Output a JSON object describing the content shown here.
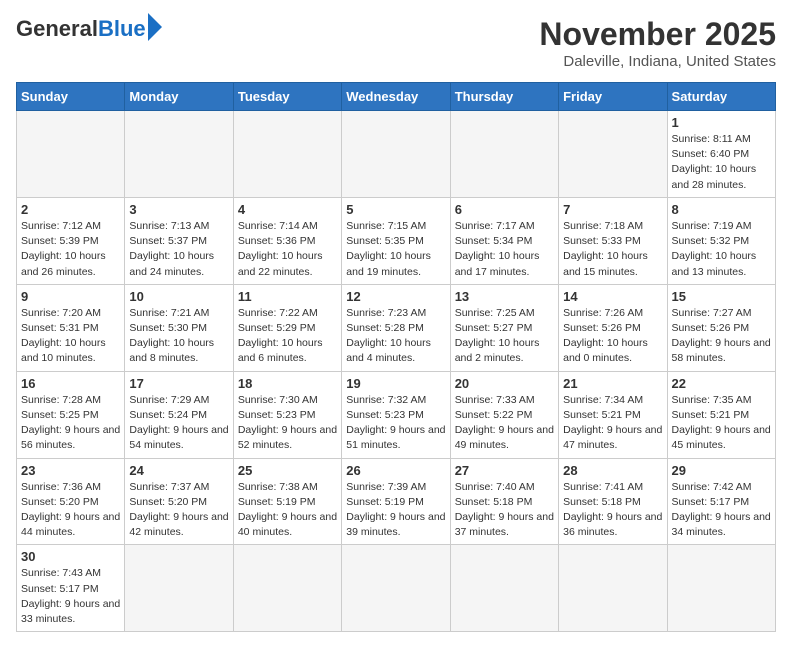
{
  "logo": {
    "general": "General",
    "blue": "Blue"
  },
  "title": "November 2025",
  "location": "Daleville, Indiana, United States",
  "weekdays": [
    "Sunday",
    "Monday",
    "Tuesday",
    "Wednesday",
    "Thursday",
    "Friday",
    "Saturday"
  ],
  "days": [
    {
      "day": "",
      "info": ""
    },
    {
      "day": "",
      "info": ""
    },
    {
      "day": "",
      "info": ""
    },
    {
      "day": "",
      "info": ""
    },
    {
      "day": "",
      "info": ""
    },
    {
      "day": "",
      "info": ""
    },
    {
      "day": "1",
      "info": "Sunrise: 8:11 AM\nSunset: 6:40 PM\nDaylight: 10 hours\nand 28 minutes."
    },
    {
      "day": "2",
      "info": "Sunrise: 7:12 AM\nSunset: 5:39 PM\nDaylight: 10 hours\nand 26 minutes."
    },
    {
      "day": "3",
      "info": "Sunrise: 7:13 AM\nSunset: 5:37 PM\nDaylight: 10 hours\nand 24 minutes."
    },
    {
      "day": "4",
      "info": "Sunrise: 7:14 AM\nSunset: 5:36 PM\nDaylight: 10 hours\nand 22 minutes."
    },
    {
      "day": "5",
      "info": "Sunrise: 7:15 AM\nSunset: 5:35 PM\nDaylight: 10 hours\nand 19 minutes."
    },
    {
      "day": "6",
      "info": "Sunrise: 7:17 AM\nSunset: 5:34 PM\nDaylight: 10 hours\nand 17 minutes."
    },
    {
      "day": "7",
      "info": "Sunrise: 7:18 AM\nSunset: 5:33 PM\nDaylight: 10 hours\nand 15 minutes."
    },
    {
      "day": "8",
      "info": "Sunrise: 7:19 AM\nSunset: 5:32 PM\nDaylight: 10 hours\nand 13 minutes."
    },
    {
      "day": "9",
      "info": "Sunrise: 7:20 AM\nSunset: 5:31 PM\nDaylight: 10 hours\nand 10 minutes."
    },
    {
      "day": "10",
      "info": "Sunrise: 7:21 AM\nSunset: 5:30 PM\nDaylight: 10 hours\nand 8 minutes."
    },
    {
      "day": "11",
      "info": "Sunrise: 7:22 AM\nSunset: 5:29 PM\nDaylight: 10 hours\nand 6 minutes."
    },
    {
      "day": "12",
      "info": "Sunrise: 7:23 AM\nSunset: 5:28 PM\nDaylight: 10 hours\nand 4 minutes."
    },
    {
      "day": "13",
      "info": "Sunrise: 7:25 AM\nSunset: 5:27 PM\nDaylight: 10 hours\nand 2 minutes."
    },
    {
      "day": "14",
      "info": "Sunrise: 7:26 AM\nSunset: 5:26 PM\nDaylight: 10 hours\nand 0 minutes."
    },
    {
      "day": "15",
      "info": "Sunrise: 7:27 AM\nSunset: 5:26 PM\nDaylight: 9 hours\nand 58 minutes."
    },
    {
      "day": "16",
      "info": "Sunrise: 7:28 AM\nSunset: 5:25 PM\nDaylight: 9 hours\nand 56 minutes."
    },
    {
      "day": "17",
      "info": "Sunrise: 7:29 AM\nSunset: 5:24 PM\nDaylight: 9 hours\nand 54 minutes."
    },
    {
      "day": "18",
      "info": "Sunrise: 7:30 AM\nSunset: 5:23 PM\nDaylight: 9 hours\nand 52 minutes."
    },
    {
      "day": "19",
      "info": "Sunrise: 7:32 AM\nSunset: 5:23 PM\nDaylight: 9 hours\nand 51 minutes."
    },
    {
      "day": "20",
      "info": "Sunrise: 7:33 AM\nSunset: 5:22 PM\nDaylight: 9 hours\nand 49 minutes."
    },
    {
      "day": "21",
      "info": "Sunrise: 7:34 AM\nSunset: 5:21 PM\nDaylight: 9 hours\nand 47 minutes."
    },
    {
      "day": "22",
      "info": "Sunrise: 7:35 AM\nSunset: 5:21 PM\nDaylight: 9 hours\nand 45 minutes."
    },
    {
      "day": "23",
      "info": "Sunrise: 7:36 AM\nSunset: 5:20 PM\nDaylight: 9 hours\nand 44 minutes."
    },
    {
      "day": "24",
      "info": "Sunrise: 7:37 AM\nSunset: 5:20 PM\nDaylight: 9 hours\nand 42 minutes."
    },
    {
      "day": "25",
      "info": "Sunrise: 7:38 AM\nSunset: 5:19 PM\nDaylight: 9 hours\nand 40 minutes."
    },
    {
      "day": "26",
      "info": "Sunrise: 7:39 AM\nSunset: 5:19 PM\nDaylight: 9 hours\nand 39 minutes."
    },
    {
      "day": "27",
      "info": "Sunrise: 7:40 AM\nSunset: 5:18 PM\nDaylight: 9 hours\nand 37 minutes."
    },
    {
      "day": "28",
      "info": "Sunrise: 7:41 AM\nSunset: 5:18 PM\nDaylight: 9 hours\nand 36 minutes."
    },
    {
      "day": "29",
      "info": "Sunrise: 7:42 AM\nSunset: 5:17 PM\nDaylight: 9 hours\nand 34 minutes."
    },
    {
      "day": "30",
      "info": "Sunrise: 7:43 AM\nSunset: 5:17 PM\nDaylight: 9 hours\nand 33 minutes."
    },
    {
      "day": "",
      "info": ""
    },
    {
      "day": "",
      "info": ""
    },
    {
      "day": "",
      "info": ""
    },
    {
      "day": "",
      "info": ""
    },
    {
      "day": "",
      "info": ""
    },
    {
      "day": "",
      "info": ""
    }
  ]
}
